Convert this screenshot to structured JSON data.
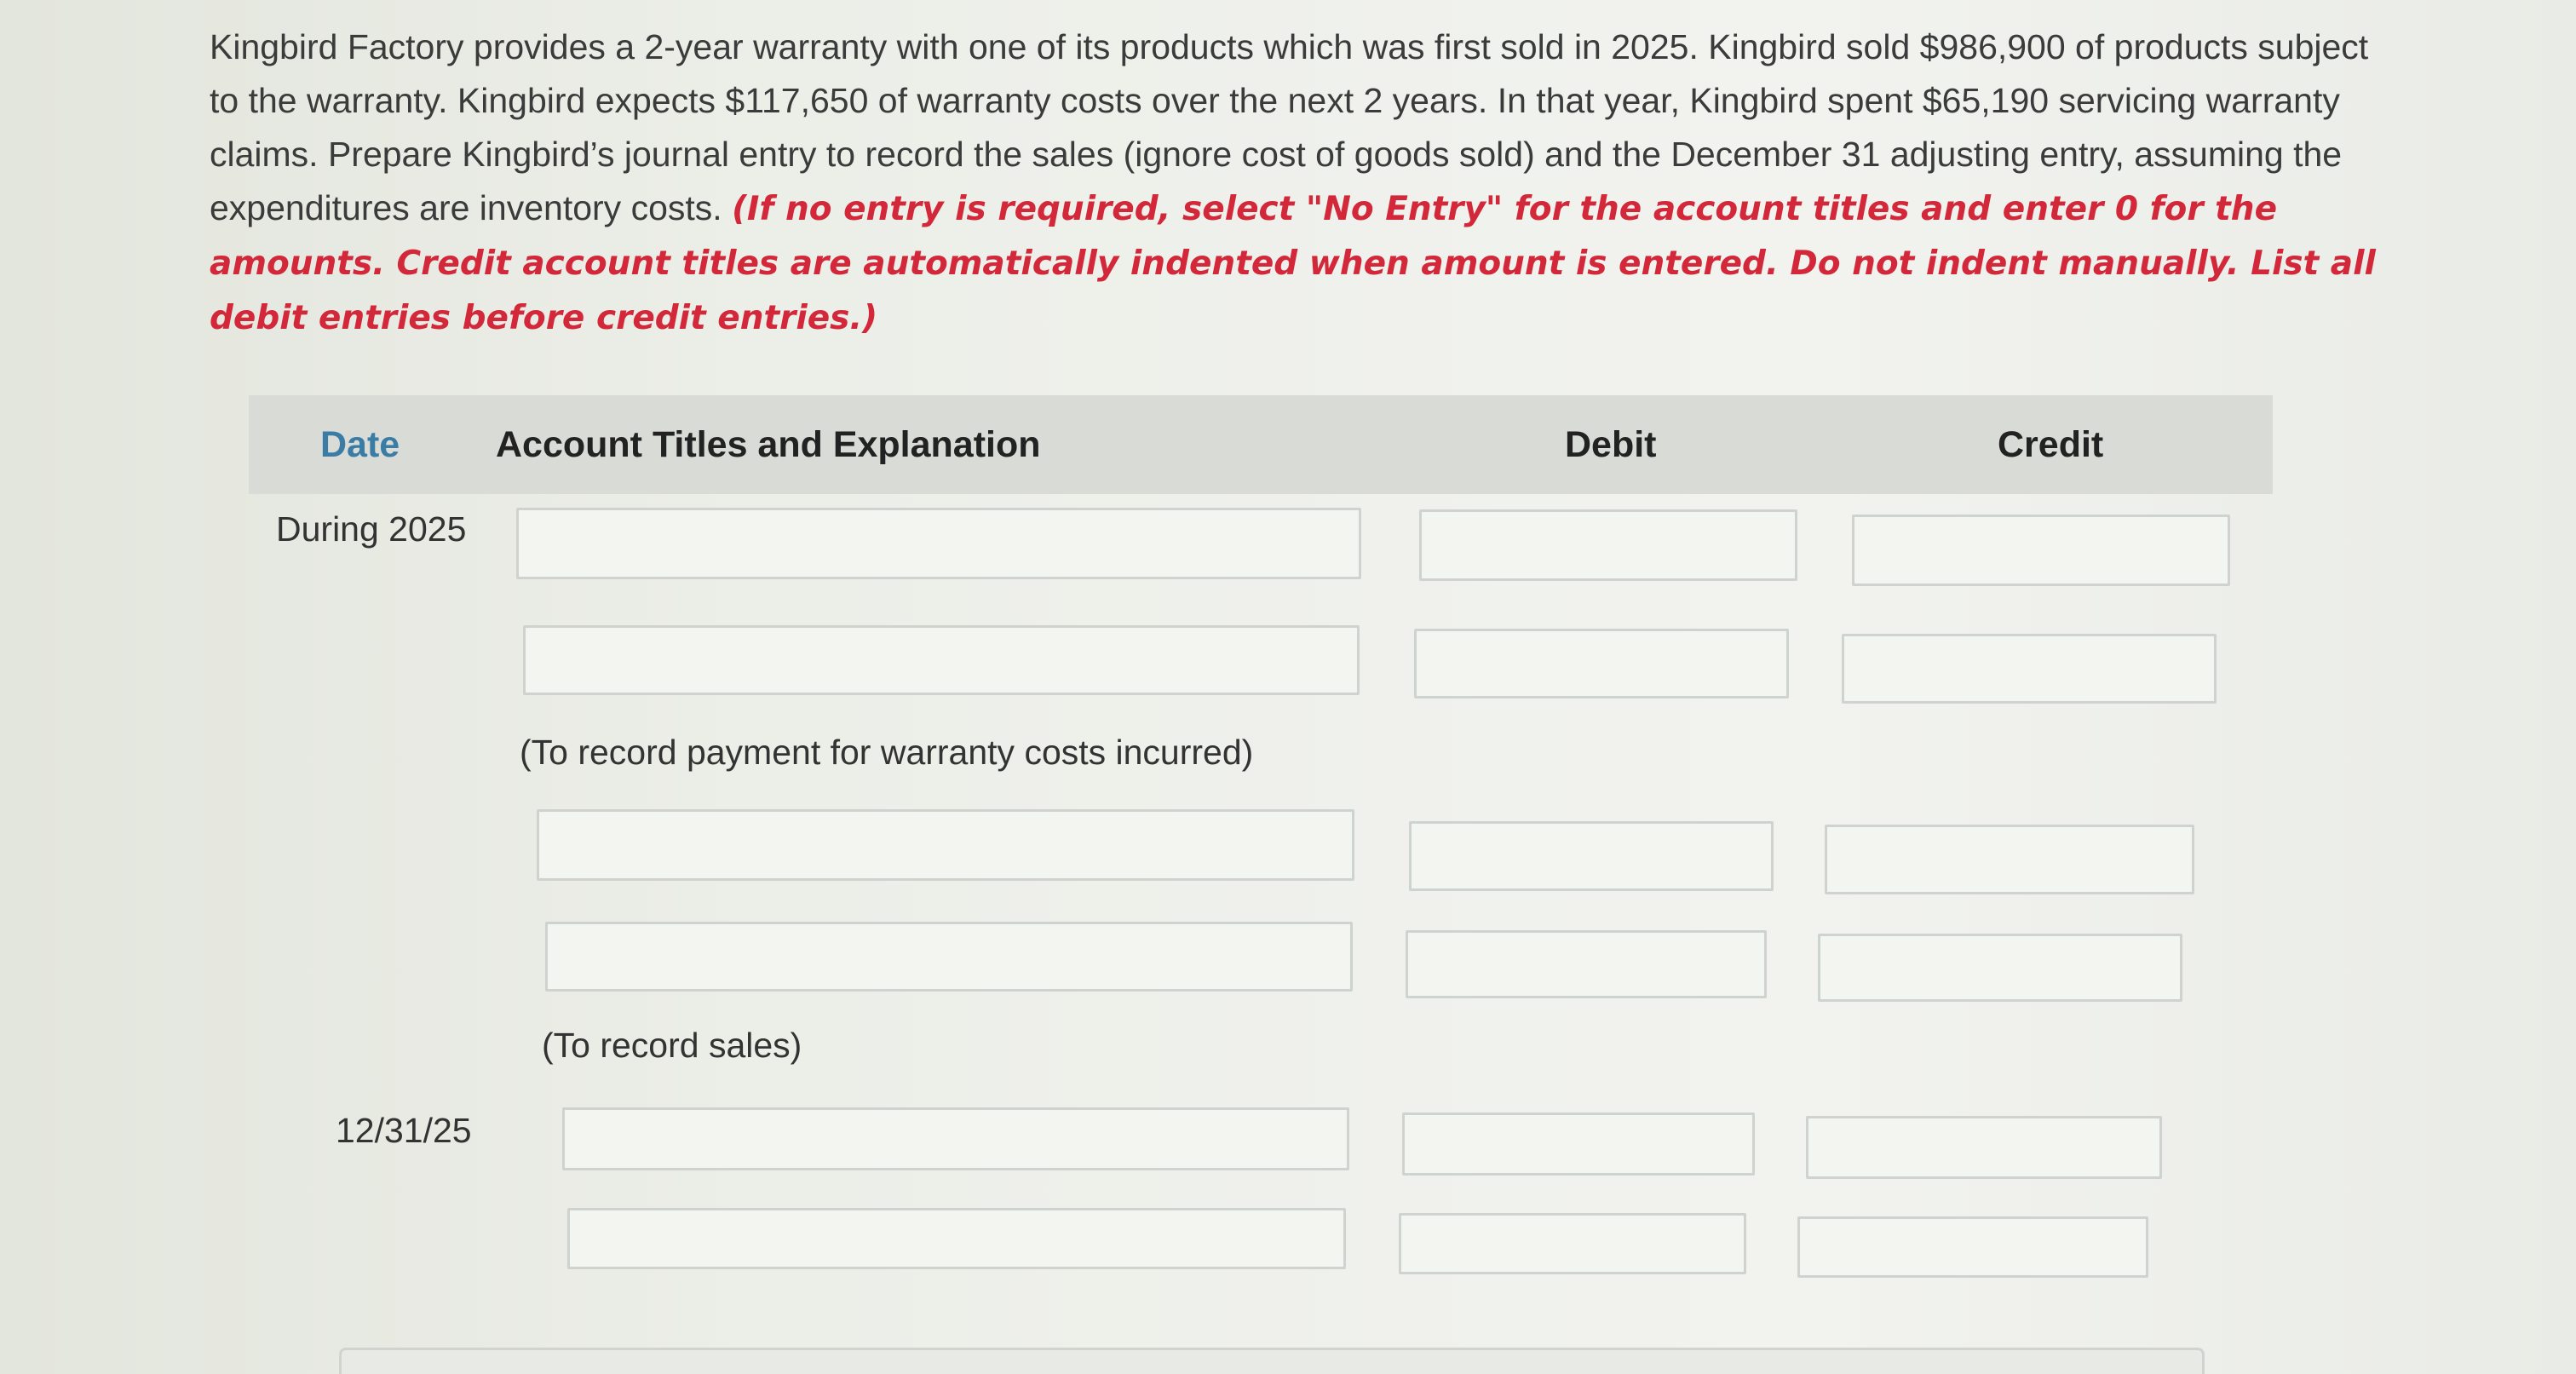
{
  "problem": {
    "text": "Kingbird Factory provides a 2-year warranty with one of its products which was first sold in 2025. Kingbird sold $986,900 of products subject to the warranty. Kingbird expects $117,650 of warranty costs over the next 2 years. In that year, Kingbird spent $65,190 servicing warranty claims. Prepare Kingbird’s journal entry to record the sales (ignore cost of goods sold) and the December 31 adjusting entry, assuming the expenditures are inventory costs.",
    "instructions": "(If no entry is required, select \"No Entry\" for the account titles and enter 0 for the amounts. Credit account titles are automatically indented when amount is entered. Do not indent manually. List all debit entries before credit entries.)"
  },
  "table": {
    "headers": {
      "date": "Date",
      "account": "Account Titles and Explanation",
      "debit": "Debit",
      "credit": "Credit"
    },
    "entries": [
      {
        "date": "During 2025",
        "note": "(To record payment for warranty costs incurred)"
      },
      {
        "date": "",
        "note": "(To record sales)"
      },
      {
        "date": "12/31/25",
        "note": ""
      }
    ]
  }
}
